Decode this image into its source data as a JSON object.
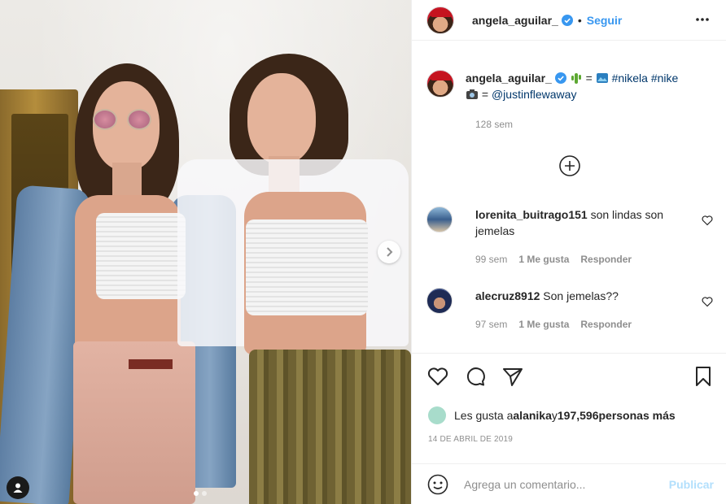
{
  "post": {
    "username": "angela_aguilar_",
    "follow_label": "Seguir",
    "separator": "•"
  },
  "caption": {
    "username": "angela_aguilar_",
    "eq1": " = ",
    "hashtags": "#nikela #nike",
    "eq2": " = ",
    "mention": "@justinflewaway",
    "time": "128 sem"
  },
  "comments": [
    {
      "username": "lorenita_buitrago151",
      "text": " son lindas son jemelas",
      "time": "99 sem",
      "likes": "1 Me gusta",
      "reply": "Responder"
    },
    {
      "username": "alecruz8912",
      "text": " Son jemelas??",
      "time": "97 sem",
      "likes": "1 Me gusta",
      "reply": "Responder"
    }
  ],
  "likes_summary": {
    "prefix": "Les gusta a ",
    "user": "alanika",
    "middle": " y ",
    "count": "197,596",
    "suffix": " personas más"
  },
  "date": "14 DE ABRIL DE 2019",
  "add_comment": {
    "placeholder": "Agrega un comentario...",
    "publish_label": "Publicar"
  },
  "carousel": {
    "slides": 2,
    "active_index": 0
  },
  "colors": {
    "link_blue": "#3897f0",
    "hashtag_blue": "#00376b",
    "muted_gray": "#8e8e8e",
    "publish_disabled": "#b2dffc",
    "verified_badge": "#3897f0"
  },
  "icons": {
    "header": [
      "verified-badge-icon",
      "more-options-icon"
    ],
    "caption": [
      "cactus-emoji-icon",
      "picture-emoji-icon",
      "camera-emoji-icon"
    ],
    "actions": [
      "heart-icon",
      "comment-icon",
      "share-icon",
      "bookmark-icon"
    ],
    "misc": [
      "load-more-plus-icon",
      "comment-like-heart-icon",
      "smile-emoji-icon",
      "carousel-next-icon",
      "user-tag-icon"
    ]
  }
}
